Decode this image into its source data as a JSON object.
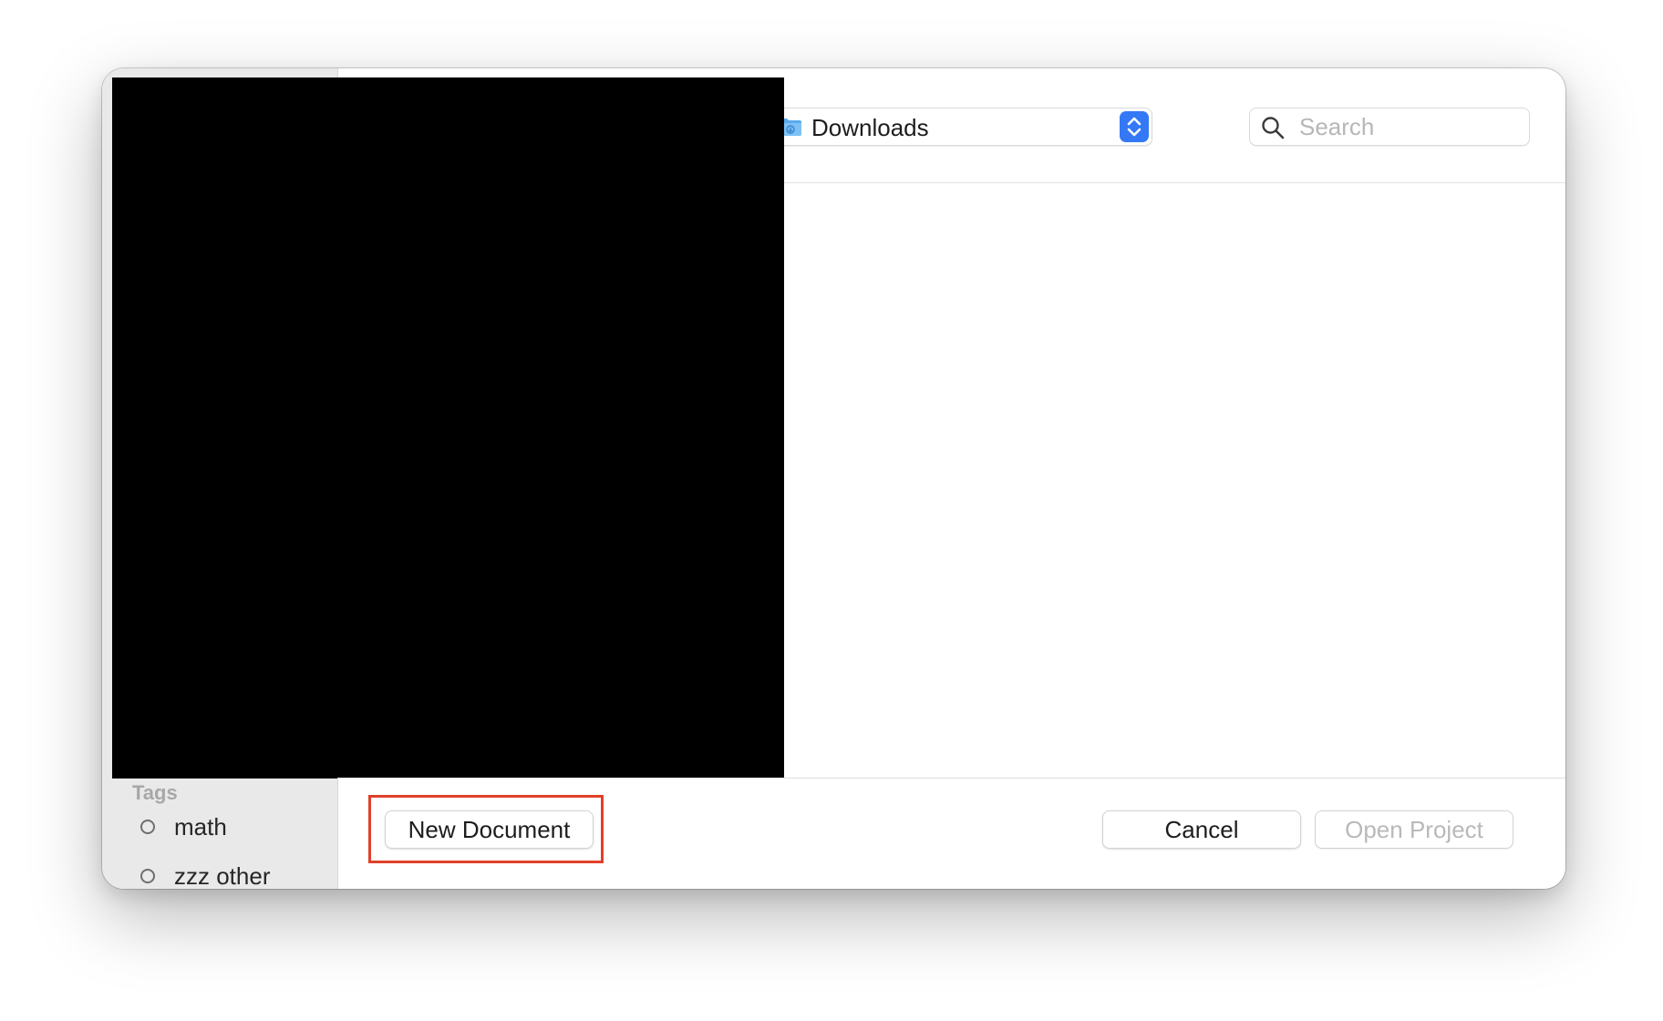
{
  "dialog": {
    "location": {
      "current_folder": "Downloads",
      "folder_icon": "downloads-folder-icon",
      "stepper_icon": "up-down-chevron-icon"
    },
    "search": {
      "placeholder": "Search",
      "value": "",
      "icon": "magnifier-icon"
    },
    "sidebar": {
      "tags_heading": "Tags",
      "tags": [
        {
          "label": "math"
        },
        {
          "label": "zzz other"
        }
      ]
    },
    "footer": {
      "new_document_label": "New Document",
      "cancel_label": "Cancel",
      "open_project_label": "Open Project",
      "open_project_enabled": false
    }
  },
  "colors": {
    "accent": "#3478f6",
    "highlight": "#e0402a",
    "sidebar_bg": "#e9e9e9",
    "redaction": "#000000"
  }
}
